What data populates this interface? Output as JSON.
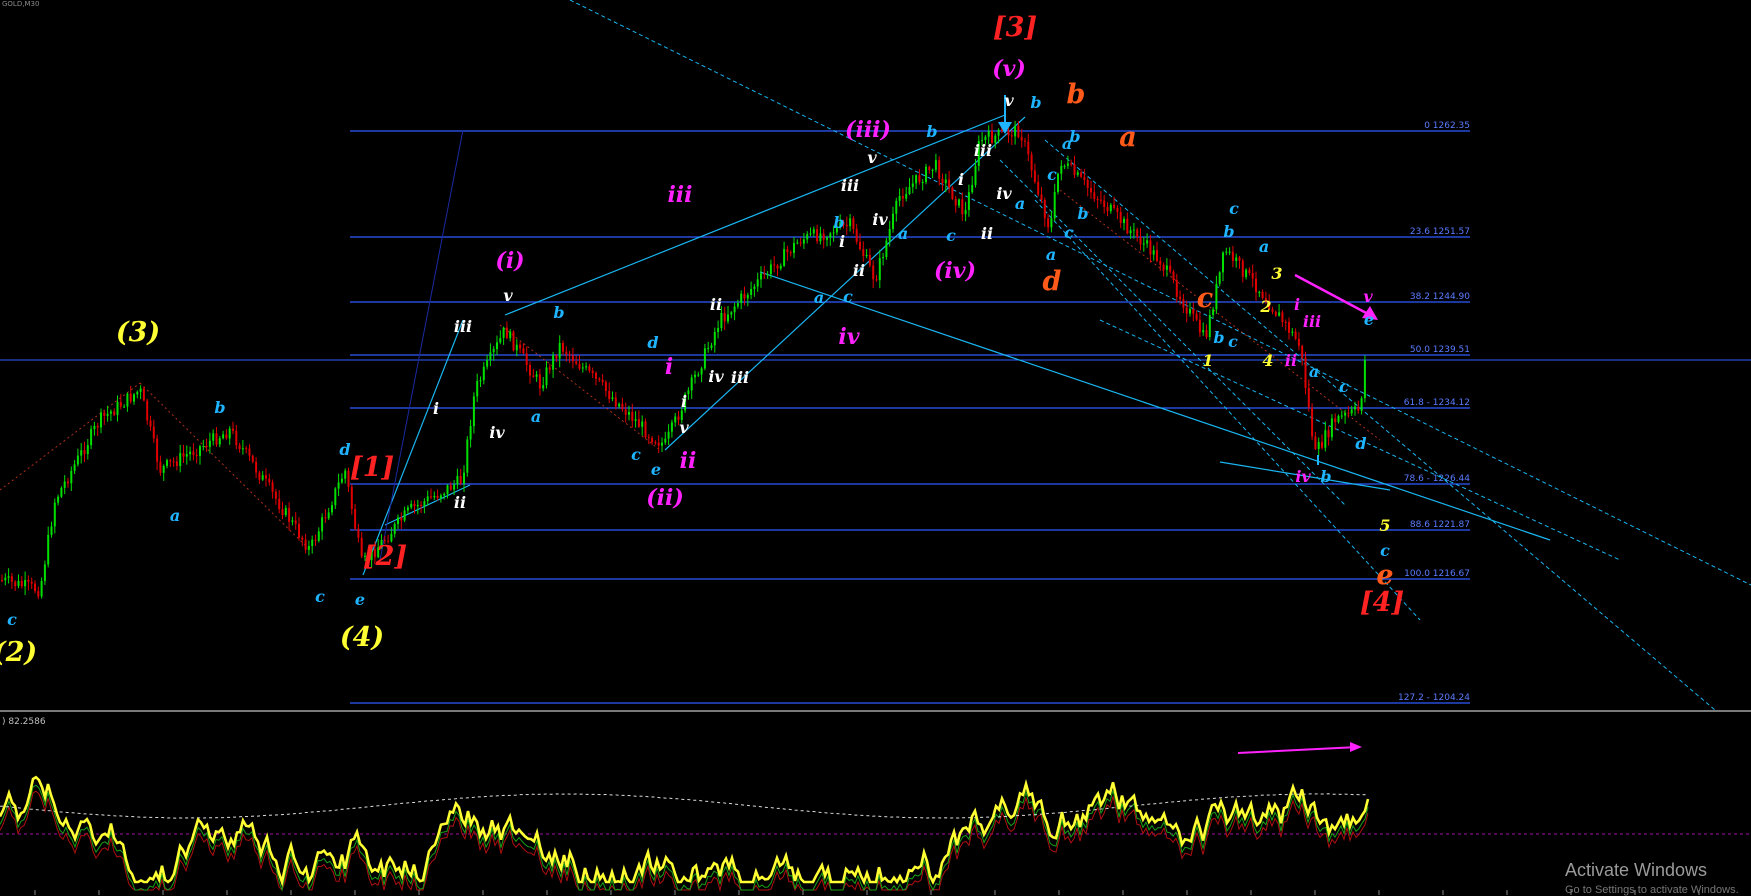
{
  "window": {
    "title": "GOLD,M30",
    "oscillator_label": ") 82.2586",
    "watermark": "Activate Windows",
    "watermark_sub": "Go to Settings to activate Windows."
  },
  "colors": {
    "background": "#000000",
    "bull_candle": "#00e000",
    "bear_candle": "#e00000",
    "fib_line": "#2f5bff",
    "fib_label": "#5b7bff",
    "channel": "#19b5f0",
    "yellow": "#ffff33",
    "magenta": "#ff22ff",
    "white": "#ffffff",
    "red": "#ff2222",
    "orange": "#ff5a1a",
    "cyan": "#1fb4ff"
  },
  "fib_levels": [
    {
      "label": "0 1262.35",
      "price": 1262.35
    },
    {
      "label": "23.6 1251.57",
      "price": 1251.57
    },
    {
      "label": "38.2 1244.90",
      "price": 1244.9
    },
    {
      "label": "50.0 1239.51",
      "price": 1239.51
    },
    {
      "label": "61.8 - 1234.12",
      "price": 1234.12
    },
    {
      "label": "78.6 - 1226.44",
      "price": 1226.44
    },
    {
      "label": "88.6 1221.87",
      "price": 1221.87
    },
    {
      "label": "100.0 1216.67",
      "price": 1216.67
    },
    {
      "label": "127.2 - 1204.24",
      "price": 1204.24
    }
  ],
  "wave_labels": [
    {
      "text": "(2)",
      "color": "yellow",
      "size": "big"
    },
    {
      "text": "c",
      "color": "cyan",
      "size": "small"
    },
    {
      "text": "(3)",
      "color": "yellow",
      "size": "big"
    },
    {
      "text": "a",
      "color": "cyan",
      "size": "small"
    },
    {
      "text": "b",
      "color": "cyan",
      "size": "small"
    },
    {
      "text": "c",
      "color": "cyan",
      "size": "small"
    },
    {
      "text": "d",
      "color": "cyan",
      "size": "small"
    },
    {
      "text": "e",
      "color": "cyan",
      "size": "small"
    },
    {
      "text": "(4)",
      "color": "yellow",
      "size": "big"
    },
    {
      "text": "[1]",
      "color": "red",
      "size": "big"
    },
    {
      "text": "[2]",
      "color": "red",
      "size": "big"
    },
    {
      "text": "i",
      "color": "white",
      "size": "small"
    },
    {
      "text": "ii",
      "color": "white",
      "size": "small"
    },
    {
      "text": "iii",
      "color": "white",
      "size": "small"
    },
    {
      "text": "iv",
      "color": "white",
      "size": "small"
    },
    {
      "text": "v",
      "color": "white",
      "size": "small"
    },
    {
      "text": "(i)",
      "color": "magenta",
      "size": "mid"
    },
    {
      "text": "a",
      "color": "cyan",
      "size": "small"
    },
    {
      "text": "b",
      "color": "cyan",
      "size": "small"
    },
    {
      "text": "c",
      "color": "cyan",
      "size": "small"
    },
    {
      "text": "d",
      "color": "cyan",
      "size": "small"
    },
    {
      "text": "e",
      "color": "cyan",
      "size": "small"
    },
    {
      "text": "(ii)",
      "color": "magenta",
      "size": "mid"
    },
    {
      "text": "i",
      "color": "magenta",
      "size": "mid"
    },
    {
      "text": "ii",
      "color": "magenta",
      "size": "mid"
    },
    {
      "text": "i",
      "color": "white",
      "size": "small"
    },
    {
      "text": "ii",
      "color": "white",
      "size": "small"
    },
    {
      "text": "iii",
      "color": "white",
      "size": "small"
    },
    {
      "text": "iv",
      "color": "white",
      "size": "small"
    },
    {
      "text": "v",
      "color": "white",
      "size": "small"
    },
    {
      "text": "iii",
      "color": "magenta",
      "size": "mid"
    },
    {
      "text": "a",
      "color": "cyan",
      "size": "small"
    },
    {
      "text": "b",
      "color": "cyan",
      "size": "small"
    },
    {
      "text": "c",
      "color": "cyan",
      "size": "small"
    },
    {
      "text": "iv",
      "color": "magenta",
      "size": "mid"
    },
    {
      "text": "i",
      "color": "white",
      "size": "small"
    },
    {
      "text": "ii",
      "color": "white",
      "size": "small"
    },
    {
      "text": "iii",
      "color": "white",
      "size": "small"
    },
    {
      "text": "iv",
      "color": "white",
      "size": "small"
    },
    {
      "text": "v",
      "color": "white",
      "size": "small"
    },
    {
      "text": "(iii)",
      "color": "magenta",
      "size": "mid"
    },
    {
      "text": "a",
      "color": "cyan",
      "size": "small"
    },
    {
      "text": "b",
      "color": "cyan",
      "size": "small"
    },
    {
      "text": "c",
      "color": "cyan",
      "size": "small"
    },
    {
      "text": "(iv)",
      "color": "magenta",
      "size": "mid"
    },
    {
      "text": "i",
      "color": "white",
      "size": "small"
    },
    {
      "text": "ii",
      "color": "white",
      "size": "small"
    },
    {
      "text": "iii",
      "color": "white",
      "size": "small"
    },
    {
      "text": "iv",
      "color": "white",
      "size": "small"
    },
    {
      "text": "v",
      "color": "white",
      "size": "small"
    },
    {
      "text": "a",
      "color": "cyan",
      "size": "small"
    },
    {
      "text": "b",
      "color": "cyan",
      "size": "small"
    },
    {
      "text": "(v)",
      "color": "magenta",
      "size": "mid"
    },
    {
      "text": "[3]",
      "color": "red",
      "size": "big"
    },
    {
      "text": "b",
      "color": "orange",
      "size": "big"
    },
    {
      "text": "a",
      "color": "cyan",
      "size": "small"
    },
    {
      "text": "c",
      "color": "cyan",
      "size": "small"
    },
    {
      "text": "a",
      "color": "cyan",
      "size": "small"
    },
    {
      "text": "b",
      "color": "cyan",
      "size": "small"
    },
    {
      "text": "c",
      "color": "cyan",
      "size": "small"
    },
    {
      "text": "b",
      "color": "cyan",
      "size": "small"
    },
    {
      "text": "a",
      "color": "orange",
      "size": "big"
    },
    {
      "text": "d",
      "color": "orange",
      "size": "big"
    },
    {
      "text": "c",
      "color": "cyan",
      "size": "small"
    },
    {
      "text": "b",
      "color": "cyan",
      "size": "small"
    },
    {
      "text": "a",
      "color": "cyan",
      "size": "small"
    },
    {
      "text": "b",
      "color": "cyan",
      "size": "small"
    },
    {
      "text": "c",
      "color": "cyan",
      "size": "small"
    },
    {
      "text": "c",
      "color": "orange",
      "size": "big"
    },
    {
      "text": "1",
      "color": "yellow",
      "size": "small"
    },
    {
      "text": "2",
      "color": "yellow",
      "size": "small"
    },
    {
      "text": "3",
      "color": "yellow",
      "size": "small"
    },
    {
      "text": "4",
      "color": "yellow",
      "size": "small"
    },
    {
      "text": "i",
      "color": "magenta",
      "size": "small"
    },
    {
      "text": "ii",
      "color": "magenta",
      "size": "small"
    },
    {
      "text": "iii",
      "color": "magenta",
      "size": "small"
    },
    {
      "text": "iv",
      "color": "magenta",
      "size": "small"
    },
    {
      "text": "v",
      "color": "magenta",
      "size": "small"
    },
    {
      "text": "a",
      "color": "cyan",
      "size": "small"
    },
    {
      "text": "b",
      "color": "cyan",
      "size": "small"
    },
    {
      "text": "c",
      "color": "cyan",
      "size": "small"
    },
    {
      "text": "d",
      "color": "cyan",
      "size": "small"
    },
    {
      "text": "e",
      "color": "cyan",
      "size": "small"
    },
    {
      "text": "5",
      "color": "yellow",
      "size": "small"
    },
    {
      "text": "c",
      "color": "cyan",
      "size": "small"
    },
    {
      "text": "e",
      "color": "orange",
      "size": "big"
    },
    {
      "text": "[4]",
      "color": "red",
      "size": "big"
    }
  ]
}
